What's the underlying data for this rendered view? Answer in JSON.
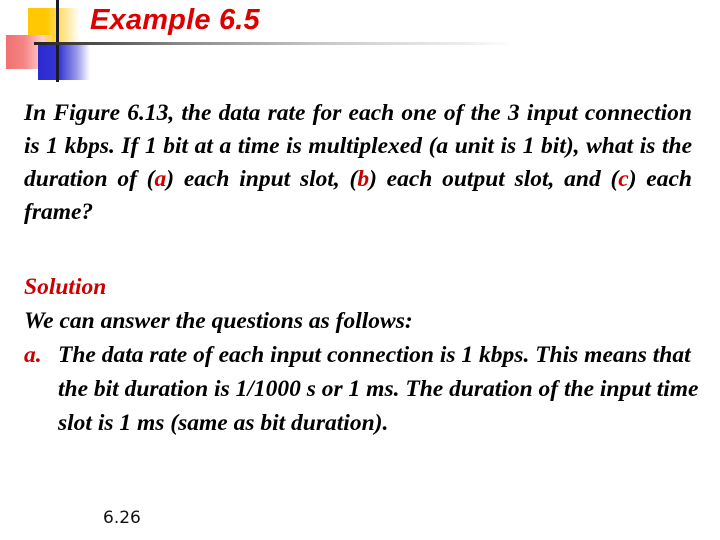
{
  "slide": {
    "title": "Example 6.5",
    "question": {
      "part1": "In Figure 6.13, the data rate for each one of the 3 input connection is 1 kbps. If 1 bit at a time is multiplexed (a unit is 1 bit), what is the duration of (",
      "label_a": "a",
      "part2": ") each input slot, (",
      "label_b": "b",
      "part3": ") each output slot, and (",
      "label_c": "c",
      "part4": ") each frame?"
    },
    "solution": {
      "heading": "Solution",
      "intro": "We can answer the questions as follows:",
      "items": [
        {
          "marker": "a.",
          "text": "The data rate of each input connection is 1 kbps. This means that the bit duration is 1/1000 s or 1 ms. The duration of the input time slot is 1 ms (same as bit duration)."
        }
      ]
    },
    "page_number": "6.26",
    "colors": {
      "title": "#dd0000",
      "highlight": "#cc0000",
      "text": "#000000"
    },
    "logo_icon": "overlapping-squares-crosshair-icon"
  }
}
